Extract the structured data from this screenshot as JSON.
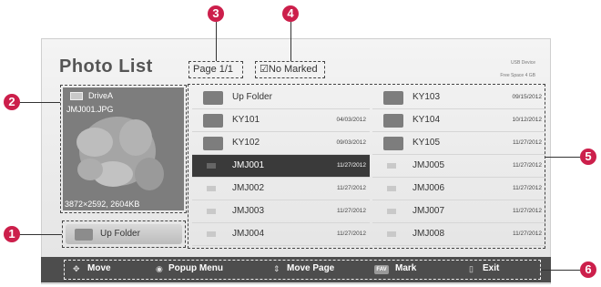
{
  "title": "Photo List",
  "header": {
    "page_label": "Page 1/1",
    "marked_label": "No Marked",
    "usb_device": "USB Device",
    "free_space": "Free Space 4 GB"
  },
  "preview": {
    "drive": "DriveA",
    "filename": "JMJ001.JPG",
    "resolution": "3872×2592, 2604KB"
  },
  "up_folder_button": "Up Folder",
  "file_list": [
    {
      "name": "Up Folder",
      "date": "",
      "kind": "folder"
    },
    {
      "name": "KY103",
      "date": "09/15/2012",
      "kind": "folder"
    },
    {
      "name": "KY101",
      "date": "04/03/2012",
      "kind": "folder"
    },
    {
      "name": "KY104",
      "date": "10/12/2012",
      "kind": "folder"
    },
    {
      "name": "KY102",
      "date": "09/03/2012",
      "kind": "folder"
    },
    {
      "name": "KY105",
      "date": "11/27/2012",
      "kind": "folder"
    },
    {
      "name": "JMJ001",
      "date": "11/27/2012",
      "kind": "photo",
      "selected": true
    },
    {
      "name": "JMJ005",
      "date": "11/27/2012",
      "kind": "photo"
    },
    {
      "name": "JMJ002",
      "date": "11/27/2012",
      "kind": "photo"
    },
    {
      "name": "JMJ006",
      "date": "11/27/2012",
      "kind": "photo"
    },
    {
      "name": "JMJ003",
      "date": "11/27/2012",
      "kind": "photo"
    },
    {
      "name": "JMJ007",
      "date": "11/27/2012",
      "kind": "photo"
    },
    {
      "name": "JMJ004",
      "date": "11/27/2012",
      "kind": "photo"
    },
    {
      "name": "JMJ008",
      "date": "11/27/2012",
      "kind": "photo"
    }
  ],
  "bottom_bar": {
    "move": "Move",
    "popup_menu": "Popup Menu",
    "move_page": "Move Page",
    "fav_key": "FAV",
    "mark": "Mark",
    "exit": "Exit"
  },
  "callouts": [
    "1",
    "2",
    "3",
    "4",
    "5",
    "6"
  ],
  "colors": {
    "callout": "#cc1f4b",
    "bottom_bar": "#4d4d4d",
    "selected_row": "#3a3a3a"
  }
}
